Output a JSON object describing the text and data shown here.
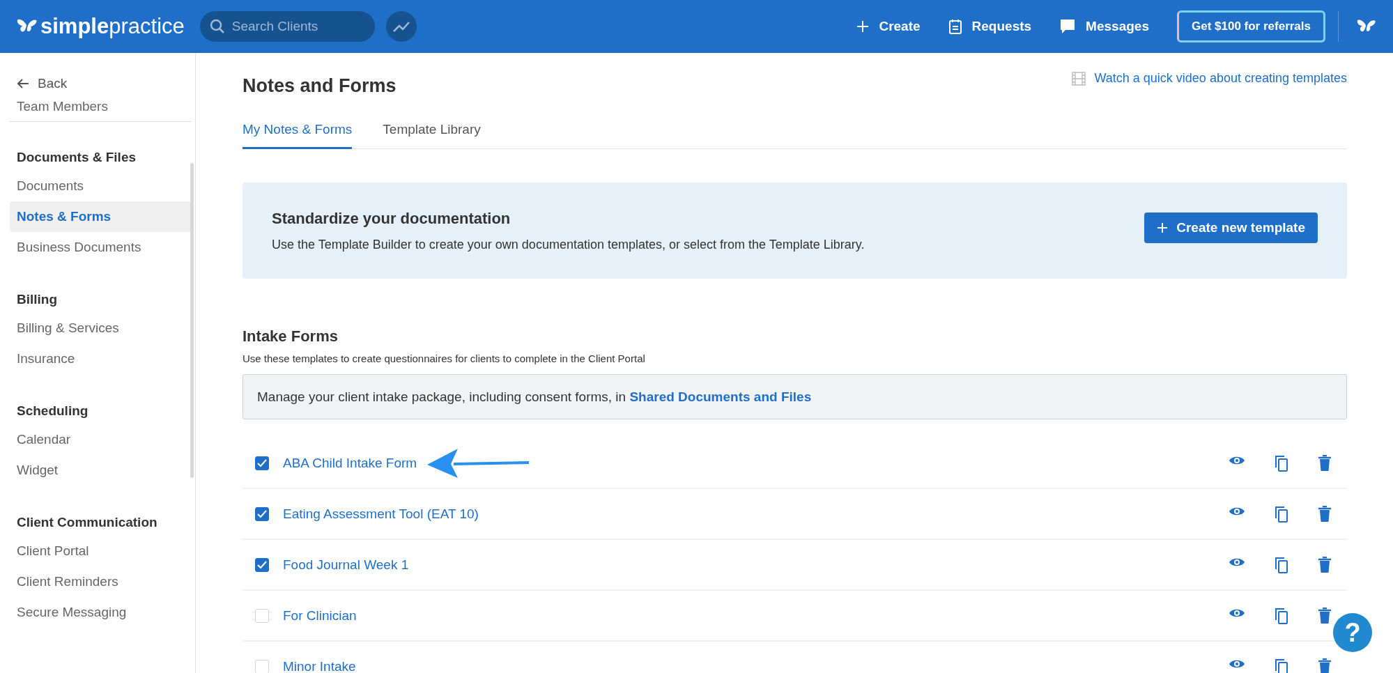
{
  "header": {
    "logo": "**simple**practice",
    "search": {
      "placeholder": "Search Clients"
    },
    "nav": [
      {
        "kind": "create",
        "label": "Create"
      },
      {
        "kind": "requests",
        "label": "Requests"
      },
      {
        "kind": "messages",
        "label": "Messages"
      }
    ],
    "referral_button": "Get $100 for referrals"
  },
  "sidebar": {
    "back": "Back",
    "top_item": "Team Members",
    "sections": [
      {
        "title": "Documents & Files",
        "items": [
          {
            "label": "Documents",
            "selected": false
          },
          {
            "label": "Notes & Forms",
            "selected": true
          },
          {
            "label": "Business Documents",
            "selected": false
          }
        ]
      },
      {
        "title": "Billing",
        "items": [
          {
            "label": "Billing & Services",
            "selected": false
          },
          {
            "label": "Insurance",
            "selected": false
          }
        ]
      },
      {
        "title": "Scheduling",
        "items": [
          {
            "label": "Calendar",
            "selected": false
          },
          {
            "label": "Widget",
            "selected": false
          }
        ]
      },
      {
        "title": "Client Communication",
        "items": [
          {
            "label": "Client Portal",
            "selected": false
          },
          {
            "label": "Client Reminders",
            "selected": false
          },
          {
            "label": "Secure Messaging",
            "selected": false
          }
        ]
      }
    ]
  },
  "page": {
    "title": "Notes and Forms",
    "video_link": "Watch a quick video about creating templates",
    "tabs": [
      {
        "label": "My Notes & Forms",
        "selected": true
      },
      {
        "label": "Template Library",
        "selected": false
      }
    ],
    "banner": {
      "title": "Standardize your documentation",
      "text": "Use the Template Builder to create your own documentation templates, or select from the Template Library.",
      "button": "Create new template"
    },
    "intake": {
      "title": "Intake Forms",
      "subtitle": "Use these templates to create questionnaires for clients to complete in the Client Portal",
      "notice": "Manage your client intake package, including consent forms, in",
      "notice_link": "Shared Documents and Files",
      "rows": [
        {
          "name": "ABA Child Intake Form",
          "checked": true
        },
        {
          "name": "Eating Assessment Tool (EAT 10)",
          "checked": true
        },
        {
          "name": "Food Journal Week 1",
          "checked": true
        },
        {
          "name": "For Clinician",
          "checked": false
        },
        {
          "name": "Minor Intake",
          "checked": false
        }
      ]
    }
  },
  "help_button": "?"
}
